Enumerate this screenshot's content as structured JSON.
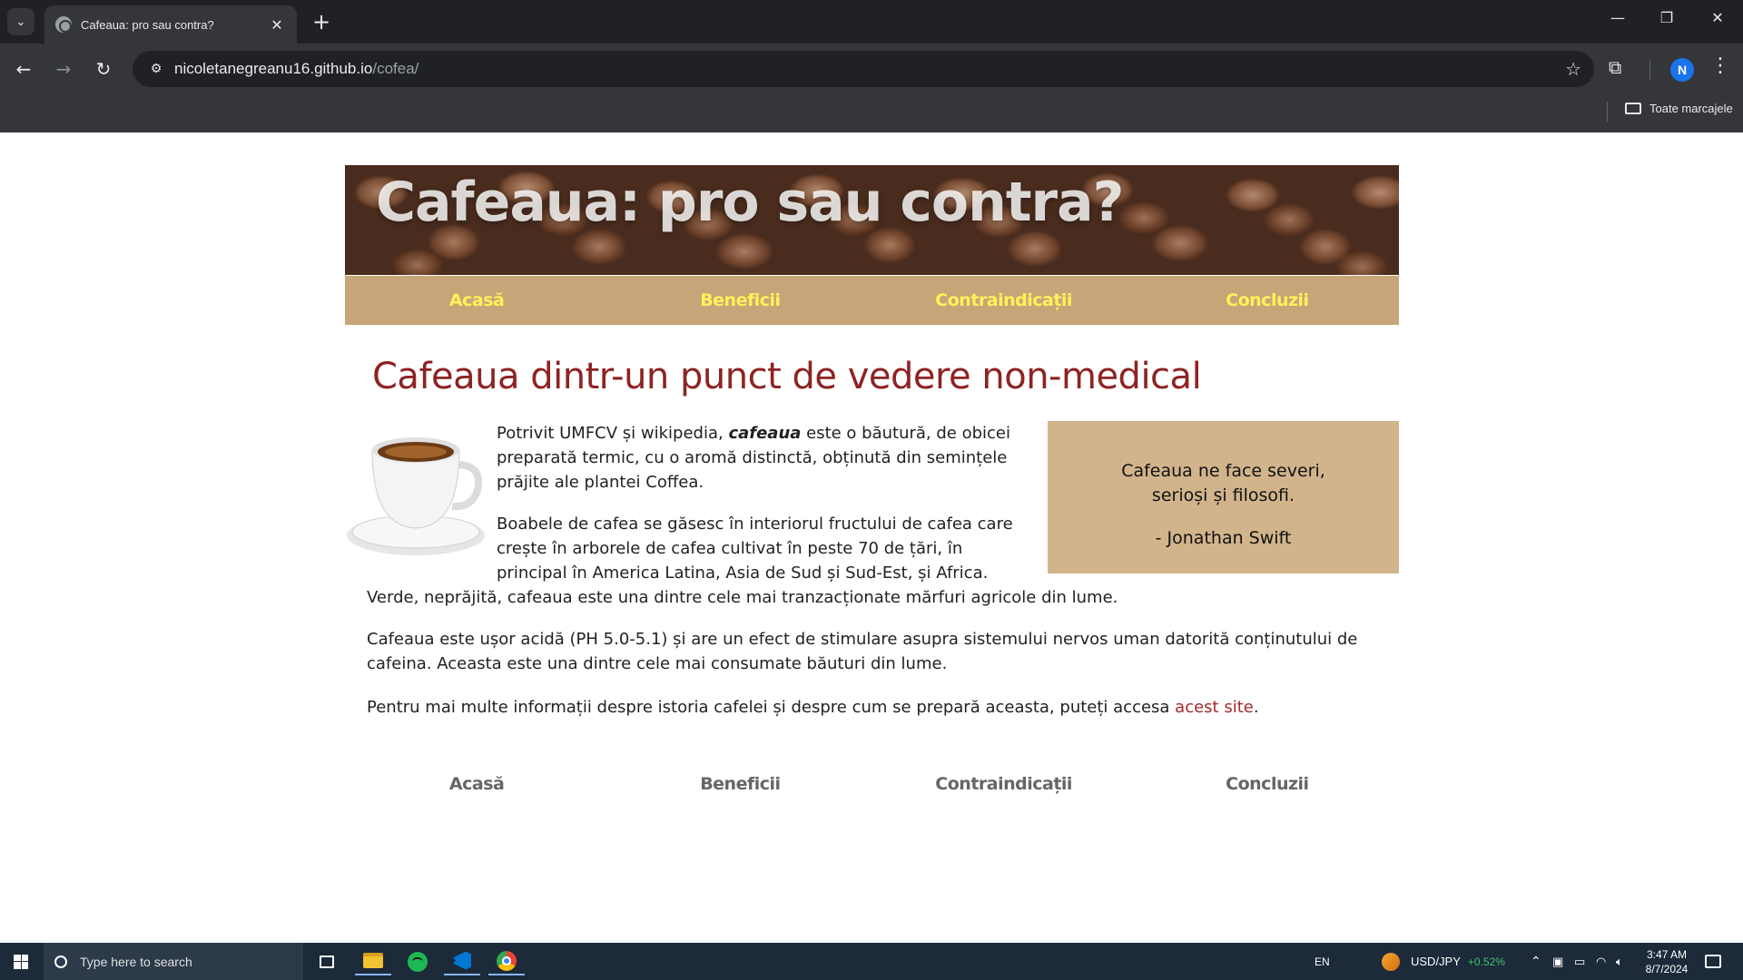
{
  "browser": {
    "tab_title": "Cafeaua: pro sau contra?",
    "url_host": "nicoletanegreanu16.github.io",
    "url_path": "/cofea/",
    "profile_initial": "N",
    "bookmarks_all_label": "Toate marcajele"
  },
  "site": {
    "banner_title": "Cafeaua: pro sau contra?",
    "nav": [
      "Acasă",
      "Beneficii",
      "Contraindicații",
      "Concluzii"
    ],
    "heading": "Cafeaua dintr-un punct de vedere non-medical",
    "p1_before": "Potrivit UMFCV și wikipedia, ",
    "p1_emph": "cafeaua",
    "p1_after": " este o băutură, de obicei preparată termic, cu o aromă distinctă, obținută din semințele prăjite ale plantei Coffea.",
    "p2_wrapped": "Boabele de cafea se găsesc în interiorul fructului de cafea care crește în arborele de cafea cultivat în peste 70 de țări, în principal în America Latina, Asia de Sud și Sud-Est, și Africa.",
    "p2_tail": "Verde, neprăjită, cafeaua este una dintre cele mai tranzacționate mărfuri agricole din lume.",
    "p3": "Cafeaua este ușor acidă (PH 5.0-5.1) și are un efect de stimulare asupra sistemului nervos uman datorită conținutului de cafeina. Aceasta este una dintre cele mai consumate băuturi din lume.",
    "p4_before": "Pentru mai multe informații despre istoria cafelei și despre cum se prepară aceasta, puteți accesa ",
    "p4_link": "acest site",
    "p4_after": ".",
    "quote_line1": "Cafeaua ne face severi,",
    "quote_line2": "serioși și filosofi.",
    "quote_author": "- Jonathan Swift",
    "colors": {
      "heading": "#8e2323",
      "nav_bg": "#c8a578",
      "nav_text": "#fff25a",
      "quote_bg": "#d2b48c",
      "link": "#a52a2a"
    }
  },
  "taskbar": {
    "search_placeholder": "Type here to search",
    "lang": "EN",
    "ticker": "USD/JPY",
    "ticker_change": "+0.52%",
    "time": "3:47 AM",
    "date": "8/7/2024",
    "pinned_icons": [
      "task-view-icon",
      "file-explorer-icon",
      "spotify-icon",
      "vscode-icon",
      "chrome-icon"
    ]
  }
}
